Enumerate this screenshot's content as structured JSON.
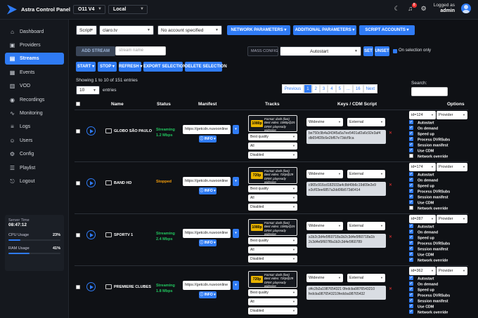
{
  "header": {
    "app_title": "Astra Control Panel",
    "server_select": "O11 V4",
    "location_select": "Local",
    "moon_icon": "moon-icon",
    "bell_icon": "bell-icon",
    "notifications_count": "8",
    "gear_icon": "gear-icon",
    "logged_label": "Logged as",
    "username": "admin"
  },
  "sidebar": {
    "items": [
      {
        "label": "Dashboard",
        "icon": "dashboard-icon",
        "glyph": "⌂"
      },
      {
        "label": "Providers",
        "icon": "providers-icon",
        "glyph": "▣"
      },
      {
        "label": "Streams",
        "icon": "streams-icon",
        "glyph": "▤"
      },
      {
        "label": "Events",
        "icon": "events-icon",
        "glyph": "▦"
      },
      {
        "label": "VOD",
        "icon": "vod-icon",
        "glyph": "▥"
      },
      {
        "label": "Recordings",
        "icon": "recordings-icon",
        "glyph": "◉"
      },
      {
        "label": "Monitoring",
        "icon": "monitoring-icon",
        "glyph": "∿"
      },
      {
        "label": "Logs",
        "icon": "logs-icon",
        "glyph": "≡"
      },
      {
        "label": "Users",
        "icon": "users-icon",
        "glyph": "☺"
      },
      {
        "label": "Config",
        "icon": "config-icon",
        "glyph": "⚙"
      },
      {
        "label": "Playlist",
        "icon": "playlist-icon",
        "glyph": "☰"
      },
      {
        "label": "Logout",
        "icon": "logout-icon",
        "glyph": "⎋"
      }
    ],
    "active": "Streams",
    "server_time_label": "Server Time",
    "server_time": "08:47:12",
    "cpu_label": "CPU Usage",
    "cpu_value": "23%",
    "cpu_fraction": 0.23,
    "ram_label": "RAM Usage",
    "ram_value": "41%",
    "ram_fraction": 0.41
  },
  "filters": {
    "type_select": "Script",
    "script_select": "claro.tv",
    "account_select": "No account specified",
    "network_params": "NETWORK PARAMETERS",
    "additional_params": "ADDITIONAL PARAMETERS",
    "script_accounts": "SCRIPT ACCOUNTS"
  },
  "add": {
    "add_stream": "ADD STREAM",
    "stream_name_placeholder": "stream name",
    "mass_config": "MASS CONFIG",
    "mass_select": "Autostart",
    "set": "SET",
    "unset": "UNSET",
    "on_selection_only": "On selection only"
  },
  "actions": {
    "start": "START",
    "stop": "STOP",
    "refresh": "REFRESH",
    "export": "EXPORT SELECTION",
    "delete": "DELETE SELECTION"
  },
  "table_info": {
    "showing": "Showing 1 to 10 of 151 entries",
    "page_size": "10",
    "entries_label": "entries",
    "search_label": "Search:",
    "pages": [
      "Previous",
      "1",
      "2",
      "3",
      "4",
      "5",
      "...",
      "16",
      "Next"
    ],
    "current_page": "1"
  },
  "columns": {
    "name": "Name",
    "status": "Status",
    "manifest": "Manifest",
    "tracks": "Tracks",
    "keys": "Keys / CDM Script",
    "options": "Options"
  },
  "rows": [
    {
      "name": "GLOBO SÃO PAULO",
      "status": "Streaming",
      "bitrate": "1.2 Mbps",
      "status_color": "#22c55e",
      "manifest": "https://getcdn.nuvoonline",
      "info": "INFO",
      "res": "1080p",
      "track_format": "Format: dash (live)",
      "track_video": "Best video: 1080p@25",
      "track_drm": "DRM: playready",
      "track_cdm": "widevine",
      "quality": "Best quality",
      "audio": "All",
      "subs": "Disabled",
      "cdm": "Widevine",
      "key_src": "External",
      "keys": "be750c9b4a34345a5a7ee5401af2a6c92e3af4 db654f28c6e2bf67e73dcf9ca",
      "id": "id=124",
      "provider": "Provider",
      "opts": [
        {
          "label": "Autostart",
          "on": true
        },
        {
          "label": "On demand",
          "on": true
        },
        {
          "label": "Speed up",
          "on": true
        },
        {
          "label": "Process DVRSubs",
          "on": true
        },
        {
          "label": "Session manifest",
          "on": true
        },
        {
          "label": "Use CDM",
          "on": true
        },
        {
          "label": "Network override",
          "on": false
        }
      ]
    },
    {
      "name": "BAND HD",
      "status": "Stopped",
      "bitrate": "",
      "status_color": "#f59e0b",
      "manifest": "https://getcdn.nuvoonline",
      "info": "INFO",
      "res": "720p",
      "track_format": "Format: dash (live)",
      "track_video": "Best video: 720p@29",
      "track_drm": "DRM: playready",
      "track_cdm": "widevine",
      "quality": "Best quality",
      "audio": "All",
      "subs": "Disabled",
      "cdm": "Widevine",
      "key_src": "External",
      "keys": "c965c916cd182933a4c8d49b6c19d09e2e9 e3cf03ee6857a2dd06b573d0414",
      "id": "id=174",
      "provider": "Provider",
      "opts": [
        {
          "label": "Autostart",
          "on": true
        },
        {
          "label": "On demand",
          "on": true
        },
        {
          "label": "Speed up",
          "on": true
        },
        {
          "label": "Process DVRSubs",
          "on": true
        },
        {
          "label": "Session manifest",
          "on": true
        },
        {
          "label": "Use CDM",
          "on": true
        },
        {
          "label": "Network override",
          "on": false
        }
      ]
    },
    {
      "name": "SPORTV 1",
      "status": "Streaming",
      "bitrate": "2.4 Mbps",
      "status_color": "#22c55e",
      "manifest": "https://getcdn.nuvoonline",
      "info": "INFO",
      "res": "1080p",
      "track_format": "Format: dash (live)",
      "track_video": "Best video: 1080p@25",
      "track_drm": "DRM: playready",
      "track_cdm": "widevine",
      "quality": "Best quality",
      "audio": "All",
      "subs": "Disabled",
      "cdm": "Widevine",
      "key_src": "External",
      "keys": "a1b2c3d4e5f60718a1b2c3d4e5f60718a1b 2c3d4e5f607f8a1b2c3d4e5f60789",
      "id": "id=287",
      "provider": "Provider",
      "opts": [
        {
          "label": "Autostart",
          "on": true
        },
        {
          "label": "On demand",
          "on": true
        },
        {
          "label": "Speed up",
          "on": true
        },
        {
          "label": "Process DVRSubs",
          "on": true
        },
        {
          "label": "Session manifest",
          "on": true
        },
        {
          "label": "Use CDM",
          "on": true
        },
        {
          "label": "Network override",
          "on": true
        }
      ]
    },
    {
      "name": "PREMIERE CLUBES",
      "status": "Streaming",
      "bitrate": "1.8 Mbps",
      "status_color": "#22c55e",
      "manifest": "https://getcdn.nuvoonline",
      "info": "INFO",
      "res": "720p",
      "track_format": "Format: dash (live)",
      "track_video": "Best video: 720p@29",
      "track_drm": "DRM: playready",
      "track_cdm": "widevine",
      "quality": "Best quality",
      "audio": "All",
      "subs": "Disabled",
      "cdm": "Widevine",
      "key_src": "External",
      "keys": "d4c2b2a1987654321 0fedcba9876543210 fedcba9876543210fedcba98765432",
      "id": "id=362",
      "provider": "Provider",
      "opts": [
        {
          "label": "Autostart",
          "on": true
        },
        {
          "label": "On demand",
          "on": true
        },
        {
          "label": "Speed up",
          "on": true
        },
        {
          "label": "Process DVRSubs",
          "on": true
        },
        {
          "label": "Session manifest",
          "on": true
        },
        {
          "label": "Use CDM",
          "on": true
        },
        {
          "label": "Network override",
          "on": true
        }
      ]
    }
  ]
}
